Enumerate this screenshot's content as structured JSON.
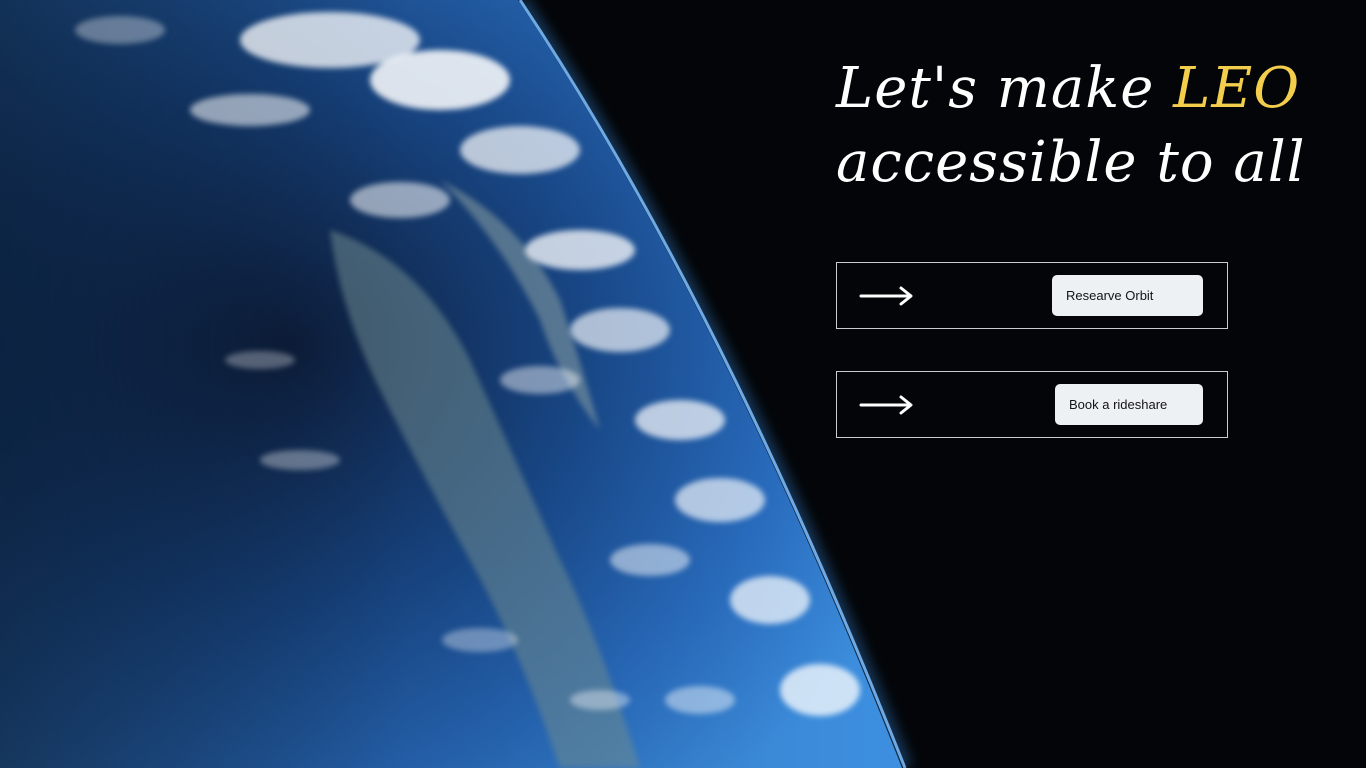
{
  "hero": {
    "headline_part1": "Let's make ",
    "headline_accent": "LEO",
    "headline_line2": "accessible to all",
    "accent_color": "#f3cd4c"
  },
  "actions": [
    {
      "label": "Researve Orbit",
      "icon": "arrow-right-icon"
    },
    {
      "label": "Book a rideshare",
      "icon": "arrow-right-icon"
    }
  ],
  "background": {
    "subject": "earth-from-orbit",
    "space_color": "#030508",
    "ocean_color": "#2a6fc4"
  }
}
